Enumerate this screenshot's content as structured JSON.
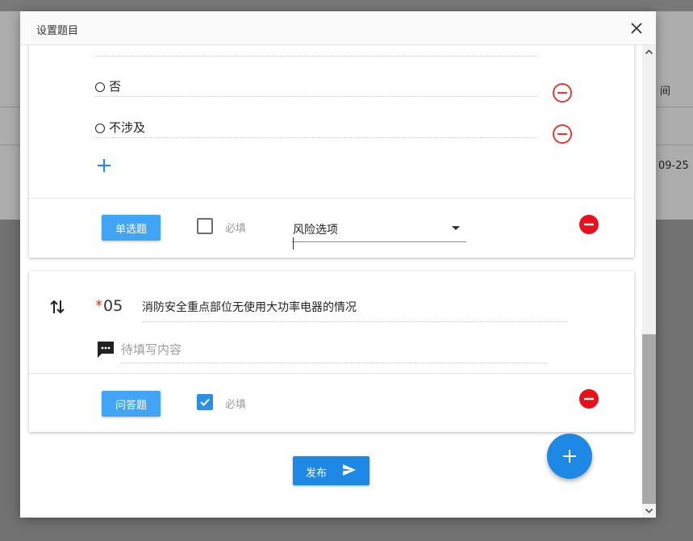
{
  "background": {
    "column_header_partial": "间",
    "date_partial": "09-25"
  },
  "dialog": {
    "title": "设置题目",
    "close_icon": "close-icon"
  },
  "question_prev": {
    "options": [
      {
        "label": "否"
      },
      {
        "label": "不涉及"
      }
    ],
    "add_option_icon": "plus-icon",
    "type_button": "单选题",
    "required_label": "必填",
    "required_checked": false,
    "risk_select": {
      "value": "风险选项"
    }
  },
  "question_05": {
    "required_mark": "*",
    "number": "05",
    "title": "消防安全重点部位无使用大功率电器的情况",
    "answer_placeholder": "待填写内容",
    "type_button": "问答题",
    "required_label": "必填",
    "required_checked": true
  },
  "actions": {
    "publish_label": "发布",
    "fab_icon": "plus-icon"
  },
  "colors": {
    "primary": "#1e88e5",
    "type_button": "#42a4f5",
    "danger": "#e53935"
  }
}
